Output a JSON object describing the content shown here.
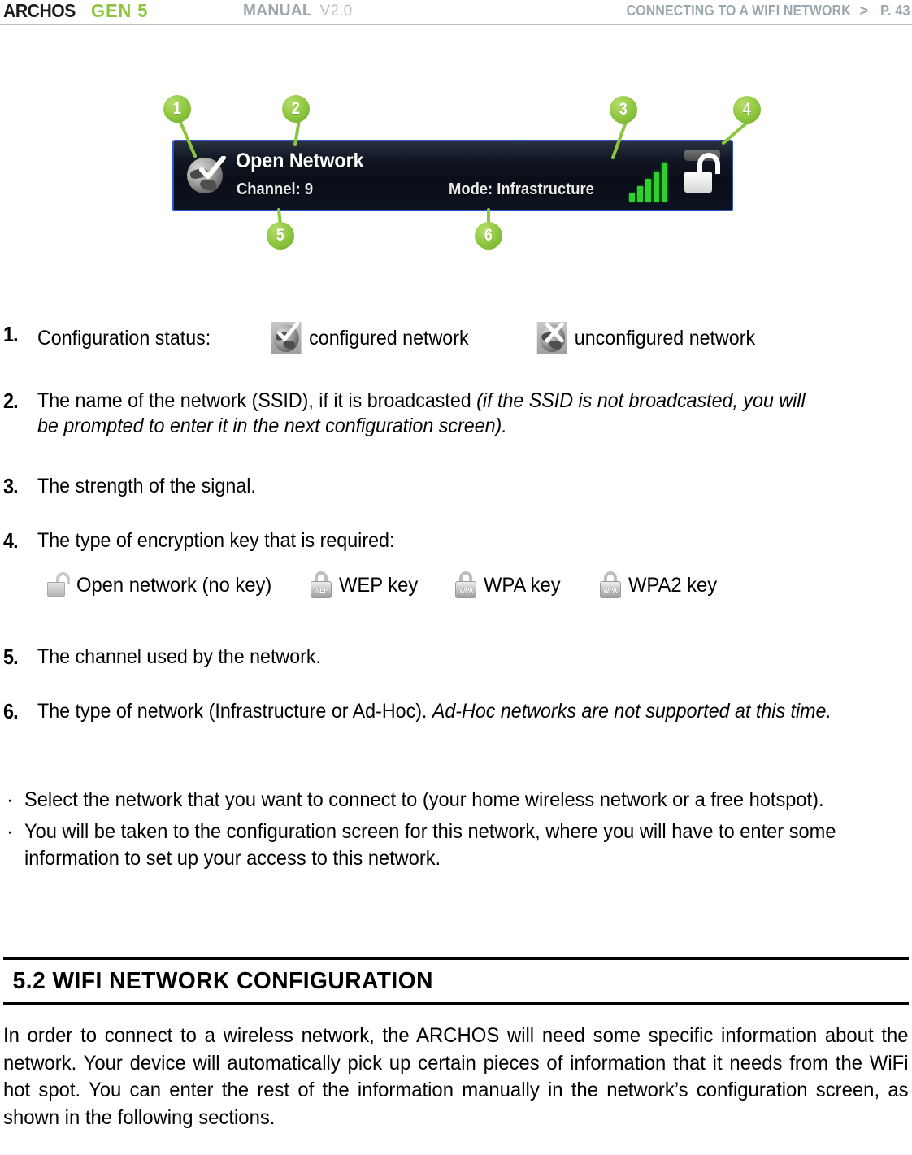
{
  "header": {
    "brand": "ARCHOS",
    "brand_model": "GEN 5",
    "manual_label": "MANUAL",
    "manual_version": "V2.0",
    "breadcrumb_title": "CONNECTING TO A WIFI NETWORK",
    "breadcrumb_separator": ">",
    "page_number": "P. 43",
    "brand_color": "#8cc63e",
    "header_text_color": "#9ba7ae"
  },
  "figure": {
    "ssid": "Open Network",
    "channel": "Channel: 9",
    "mode": "Mode: Infrastructure",
    "panel_border_color": "#2f52c8",
    "signal_color": "#2ed02e",
    "callouts": [
      {
        "number": "1",
        "label": "callout-1-configuration-status"
      },
      {
        "number": "2",
        "label": "callout-2-ssid"
      },
      {
        "number": "3",
        "label": "callout-3-signal-strength"
      },
      {
        "number": "4",
        "label": "callout-4-encryption"
      },
      {
        "number": "5",
        "label": "callout-5-channel"
      },
      {
        "number": "6",
        "label": "callout-6-mode"
      }
    ]
  },
  "list": {
    "item1": {
      "marker": "1.",
      "text": "Configuration status:",
      "configured_label": "configured network",
      "unconfigured_label": "unconfigured network"
    },
    "item2": {
      "marker": "2.",
      "text_plain": "The name of the network (SSID), if it is broadcasted ",
      "text_italic": "(if the SSID is not broadcasted, you will be prompted to enter it in the next configuration screen)."
    },
    "item3": {
      "marker": "3.",
      "text": "The strength of the signal."
    },
    "item4": {
      "marker": "4.",
      "text": "The type of encryption key that is required:"
    },
    "item5": {
      "marker": "5.",
      "text": "The channel used by the network."
    },
    "item6": {
      "marker": "6.",
      "text_plain": "The type of network (Infrastructure or Ad-Hoc). ",
      "text_italic": "Ad-Hoc networks are not supported at this time."
    }
  },
  "key_types": [
    {
      "icon": "lock-open-icon",
      "tag": "",
      "label": "Open network (no key)"
    },
    {
      "icon": "lock-closed-icon",
      "tag": "WEP",
      "label": "WEP key"
    },
    {
      "icon": "lock-closed-icon",
      "tag": "WPA",
      "label": "WPA key"
    },
    {
      "icon": "lock-closed-icon",
      "tag": "WPA",
      "label": "WPA2 key"
    }
  ],
  "bullets": {
    "dot": "·",
    "items": [
      "Select the network that you want to connect to (your home wireless network or a free hotspot).",
      "You will be taken to the configuration screen for this network, where you will have to enter some information to set up your access to this network."
    ]
  },
  "section": {
    "heading": "5.2 WIFI NETWORK CONFIGURATION"
  },
  "closing_paragraph": "In order to connect to a wireless network, the ARCHOS will need some specific information about the network. Your device will automatically pick up certain pieces of information that it needs from the WiFi hot spot. You can enter the rest of the information manually in the network’s configuration screen, as shown in the following sections."
}
